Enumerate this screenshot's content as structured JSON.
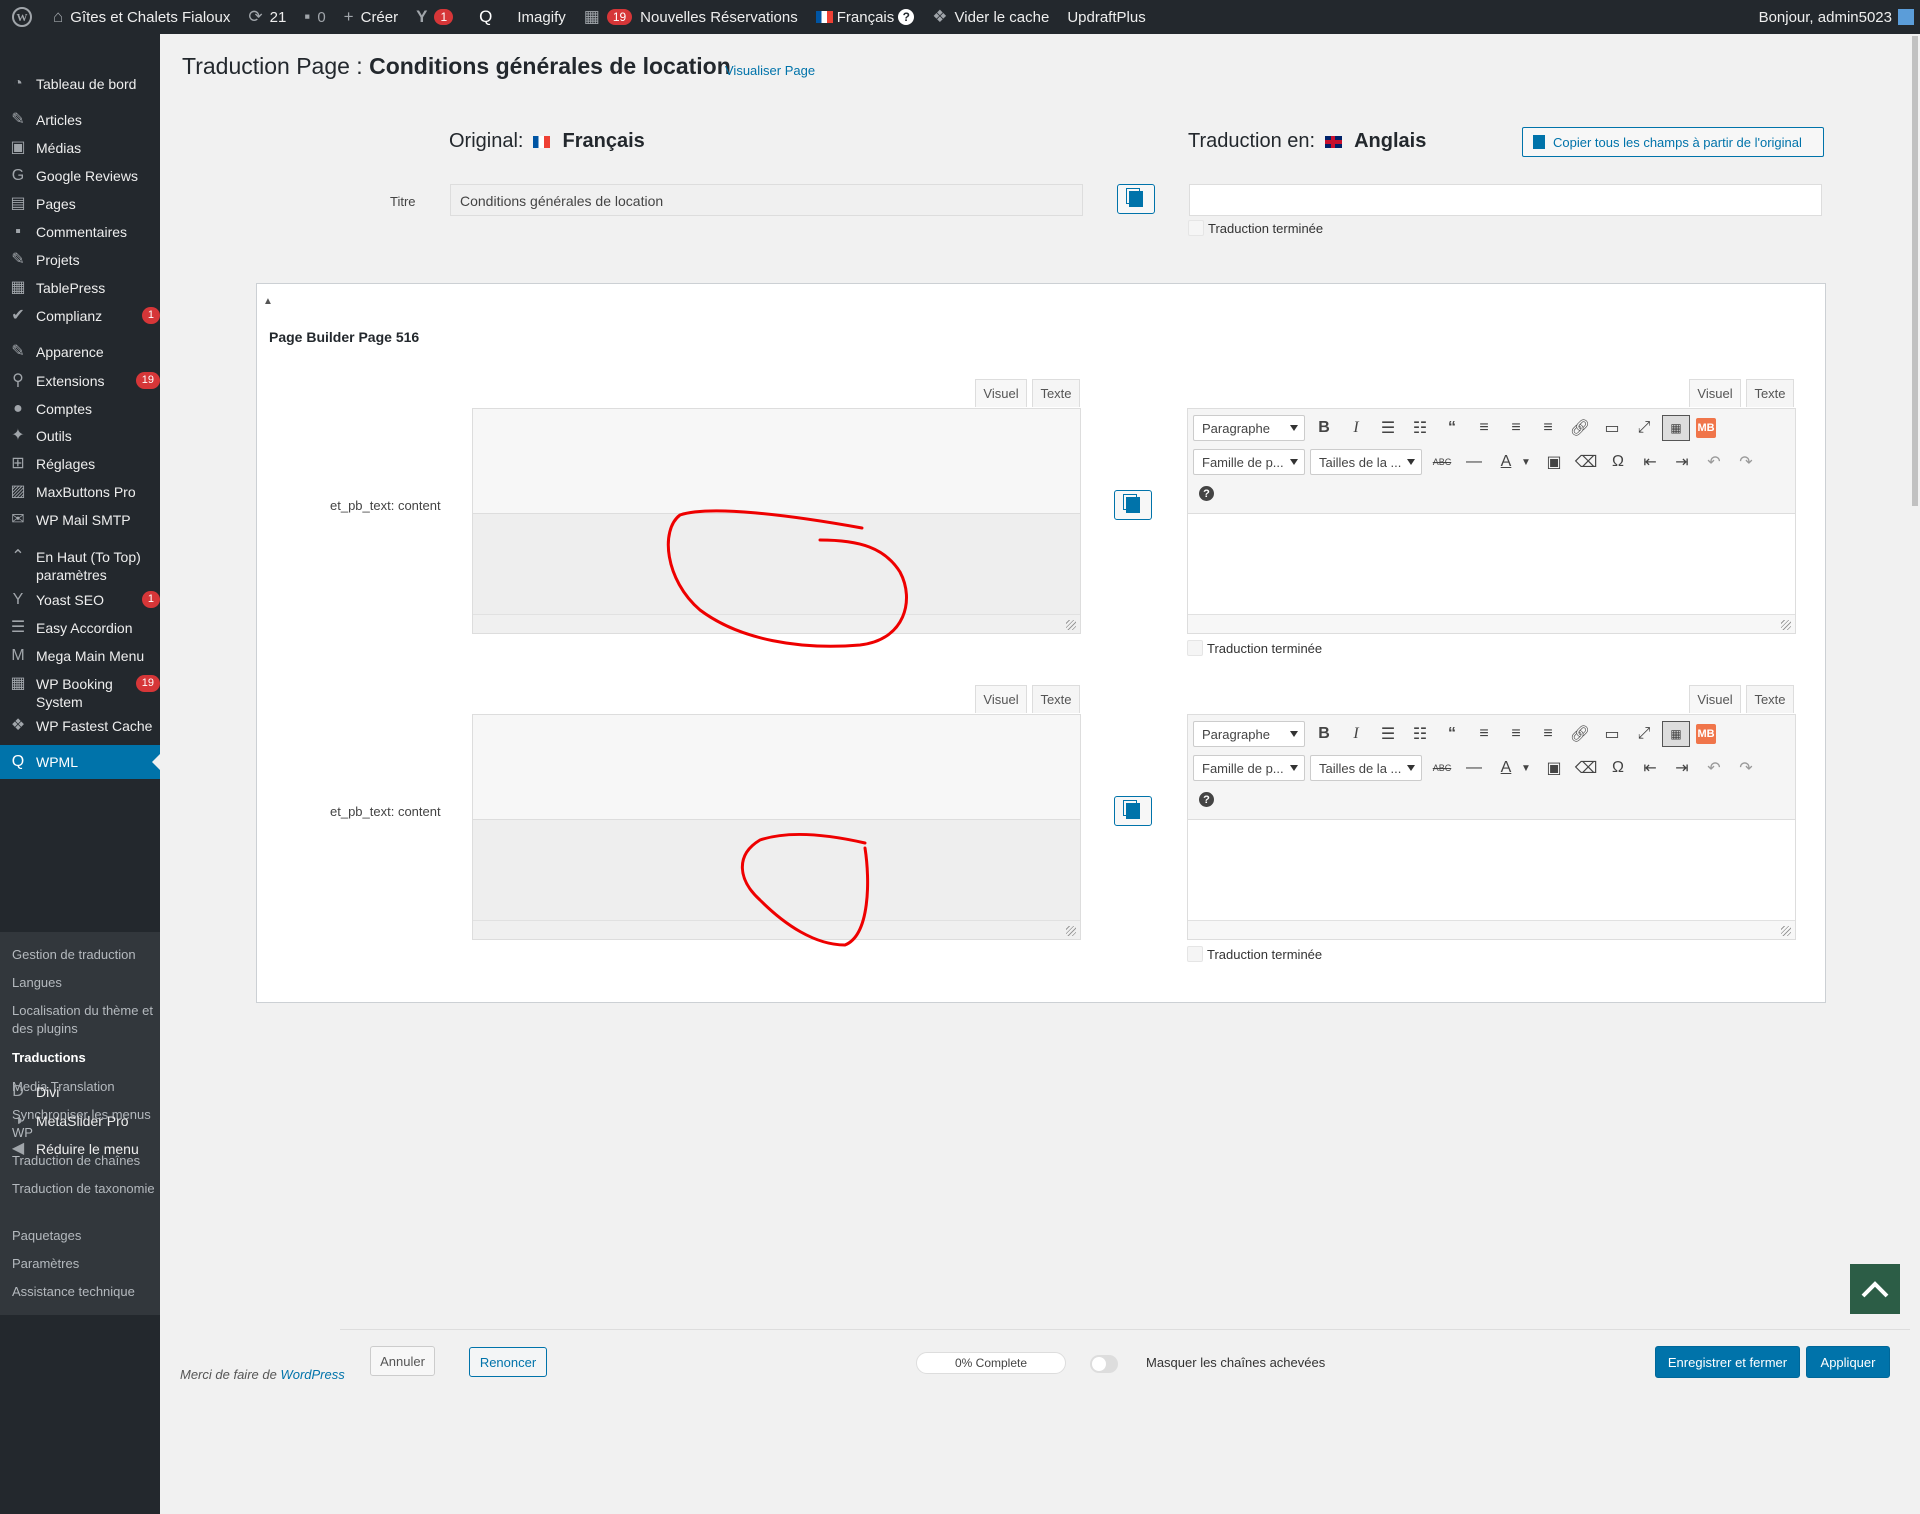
{
  "adminbar": {
    "site_name": "Gîtes et Chalets Fialoux",
    "updates_count": "21",
    "comments_count": "0",
    "new_label": "Créer",
    "yoast_badge": "1",
    "imagify_label": "Imagify",
    "reservations_badge": "19",
    "reservations_label": "Nouvelles Réservations",
    "language_label": "Français",
    "clear_cache_label": "Vider le cache",
    "updraft_label": "UpdraftPlus",
    "greeting": "Bonjour, admin5023"
  },
  "sidebar": {
    "items": [
      {
        "label": "Tableau de bord",
        "icon": "dashboard-icon"
      },
      {
        "label": "Articles",
        "icon": "pin-icon"
      },
      {
        "label": "Médias",
        "icon": "media-icon"
      },
      {
        "label": "Google Reviews",
        "icon": "google-icon"
      },
      {
        "label": "Pages",
        "icon": "pages-icon"
      },
      {
        "label": "Commentaires",
        "icon": "comment-icon"
      },
      {
        "label": "Projets",
        "icon": "pin-icon"
      },
      {
        "label": "TablePress",
        "icon": "table-icon"
      },
      {
        "label": "Complianz",
        "icon": "check-icon",
        "badge": "1"
      },
      {
        "label": "Apparence",
        "icon": "brush-icon"
      },
      {
        "label": "Extensions",
        "icon": "plugin-icon",
        "badge": "19"
      },
      {
        "label": "Comptes",
        "icon": "user-icon"
      },
      {
        "label": "Outils",
        "icon": "wrench-icon"
      },
      {
        "label": "Réglages",
        "icon": "settings-icon"
      },
      {
        "label": "MaxButtons Pro",
        "icon": "maxbuttons-icon"
      },
      {
        "label": "WP Mail SMTP",
        "icon": "mail-icon"
      },
      {
        "label": "En Haut (To Top) paramètres",
        "icon": "chevron-up-icon"
      },
      {
        "label": "Yoast SEO",
        "icon": "yoast-icon",
        "badge": "1"
      },
      {
        "label": "Easy Accordion",
        "icon": "accordion-icon"
      },
      {
        "label": "Mega Main Menu",
        "icon": "megamenu-icon"
      },
      {
        "label": "WP Booking System",
        "icon": "calendar-icon",
        "badge": "19"
      },
      {
        "label": "WP Fastest Cache",
        "icon": "cheetah-icon"
      },
      {
        "label": "WPML",
        "icon": "wpml-icon"
      },
      {
        "label": "Divi",
        "icon": "divi-icon"
      },
      {
        "label": "MetaSlider Pro",
        "icon": "metaslider-icon"
      },
      {
        "label": "Réduire le menu",
        "icon": "collapse-icon"
      }
    ],
    "submenu": [
      "Gestion de traduction",
      "Langues",
      "Localisation du thème et des plugins",
      "Traductions",
      "Media Translation",
      "Synchroniser les menus WP",
      "Traduction de chaînes",
      "Traduction de taxonomie",
      "Paquetages",
      "Paramètres",
      "Assistance technique"
    ]
  },
  "page": {
    "title_prefix": "Traduction Page : ",
    "title_name": "Conditions générales de location",
    "view_link": "Visualiser Page",
    "original_label": "Original:",
    "original_lang": "Français",
    "translation_label": "Traduction en:",
    "translation_lang": "Anglais",
    "copy_all": "Copier tous les champs à partir de l'original",
    "title_field_label": "Titre",
    "title_original_value": "Conditions générales de location",
    "translation_done": "Traduction terminée",
    "pb_title": "Page Builder Page 516",
    "field_label": "et_pb_text: content",
    "tab_visual": "Visuel",
    "tab_text": "Texte",
    "format_select": "Paragraphe",
    "font_family_select": "Famille de p...",
    "font_size_select": "Tailles de la ...",
    "mb_label": "MB"
  },
  "footer": {
    "thanks_prefix": "Merci de faire de ",
    "thanks_link": "WordPress",
    "cancel": "Annuler",
    "resign": "Renoncer",
    "progress": "0% Complete",
    "hide_completed": "Masquer les chaînes achevées",
    "save_close": "Enregistrer et fermer",
    "apply": "Appliquer"
  }
}
